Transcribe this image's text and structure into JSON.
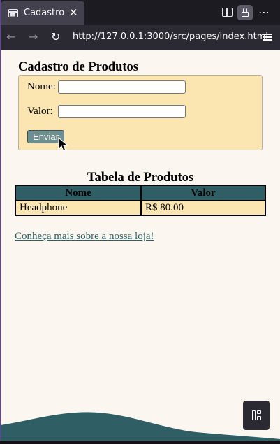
{
  "browser": {
    "tab": {
      "title": "Cadastro",
      "close_glyph": "✕",
      "icon": "page-icon"
    },
    "url": "http://127.0.0.1:3000/src/pages/index.html",
    "icons": [
      "sidebar-icon",
      "lock-icon",
      "more-icon",
      "back-icon",
      "forward-icon",
      "reload-icon",
      "menu-icon"
    ]
  },
  "form": {
    "title": "Cadastro de Produtos",
    "nome_label": "Nome:",
    "nome_value": "",
    "valor_label": "Valor:",
    "valor_value": "",
    "submit_label": "Enviar"
  },
  "table": {
    "title": "Tabela de Produtos",
    "headers": [
      "Nome",
      "Valor"
    ],
    "rows": [
      {
        "nome": "Headphone",
        "valor": "R$ 80.00"
      }
    ]
  },
  "link_text": "Conheça mais sobre a nossa loja!",
  "colors": {
    "accent": "#2f5f64",
    "form_bg": "#fbe6b1",
    "page_bg": "#fbf7f0"
  }
}
